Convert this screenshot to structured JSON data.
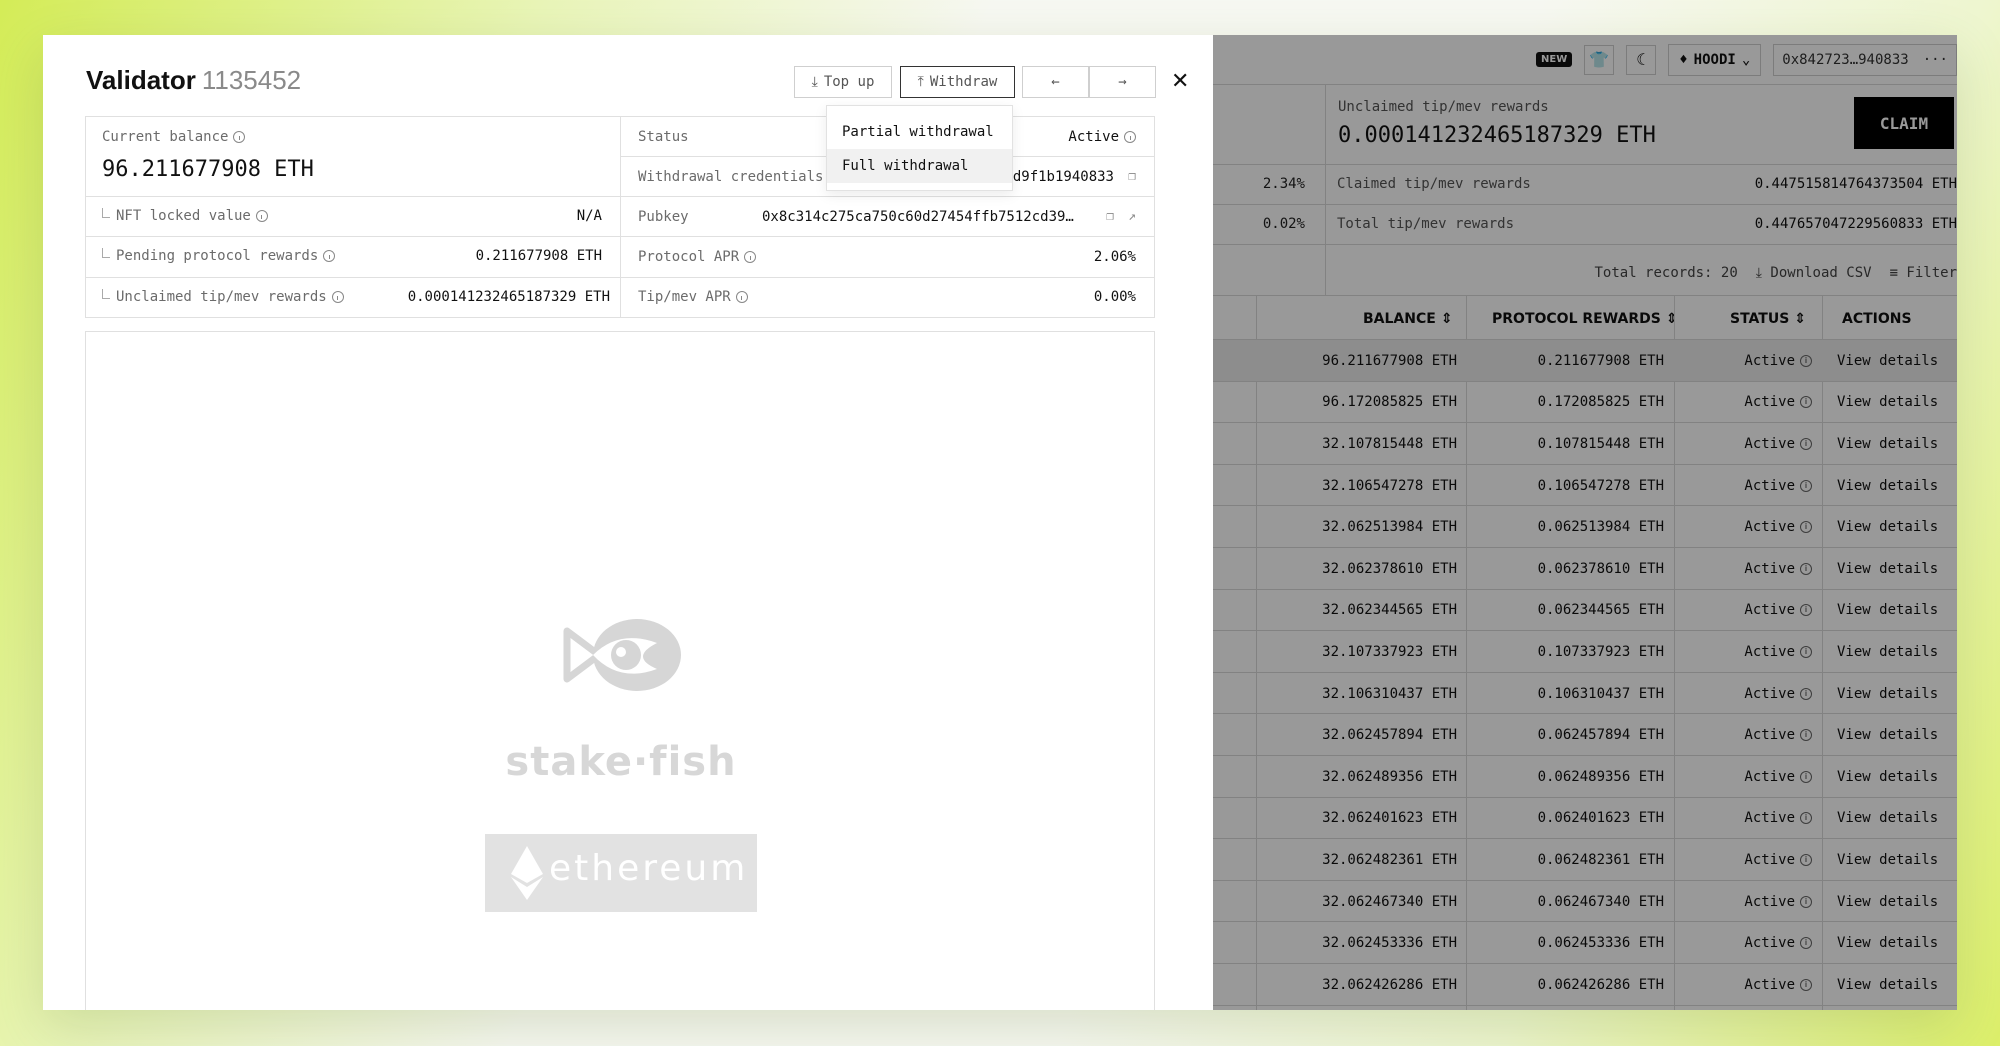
{
  "modal": {
    "title": "Validator",
    "validator_id": "1135452",
    "buttons": {
      "top_up": "Top up",
      "withdraw": "Withdraw",
      "prev": "←",
      "next": "→",
      "close": "✕"
    },
    "withdraw_menu": [
      "Partial withdrawal",
      "Full withdrawal"
    ],
    "current_balance_label": "Current balance",
    "current_balance": "96.211677908 ETH",
    "nft_locked_label": "NFT locked value",
    "nft_locked_value": "N/A",
    "pending_protocol_label": "Pending protocol rewards",
    "pending_protocol_value": "0.211677908 ETH",
    "unclaimed_label": "Unclaimed tip/mev rewards",
    "unclaimed_value": "0.000141232465187329 ETH",
    "status_label": "Status",
    "status_value": "Active",
    "withdrawal_cred_label": "Withdrawal credentials",
    "withdrawal_cred_value": "d9f1b1940833",
    "pubkey_label": "Pubkey",
    "pubkey_value": "0x8c314c275ca750c60d27454ffb7512cd39…",
    "protocol_apr_label": "Protocol APR",
    "protocol_apr_value": "2.06%",
    "tipmev_apr_label": "Tip/mev APR",
    "tipmev_apr_value": "0.00%",
    "art_brand": "stake·fish",
    "art_chain": "ethereum"
  },
  "dashboard": {
    "new_badge": "NEW",
    "network": "HOODI",
    "address": "0x842723…940833",
    "more": "···",
    "unclaimed_label": "Unclaimed tip/mev rewards",
    "unclaimed_value": "0.000141232465187329 ETH",
    "claim_button": "CLAIM",
    "rows": [
      {
        "pct": "2.34%",
        "label": "Claimed tip/mev rewards",
        "value": "0.447515814764373504 ETH"
      },
      {
        "pct": "0.02%",
        "label": "Total tip/mev rewards",
        "value": "0.447657047229560833 ETH"
      }
    ],
    "total_records": "Total records: 20",
    "download_csv": "Download CSV",
    "filter": "Filter",
    "columns": [
      "BALANCE",
      "PROTOCOL REWARDS",
      "STATUS",
      "ACTIONS"
    ],
    "table": [
      {
        "balance": "96.211677908 ETH",
        "rewards": "0.211677908 ETH",
        "status": "Active",
        "action": "View details"
      },
      {
        "balance": "96.172085825 ETH",
        "rewards": "0.172085825 ETH",
        "status": "Active",
        "action": "View details"
      },
      {
        "balance": "32.107815448 ETH",
        "rewards": "0.107815448 ETH",
        "status": "Active",
        "action": "View details"
      },
      {
        "balance": "32.106547278 ETH",
        "rewards": "0.106547278 ETH",
        "status": "Active",
        "action": "View details"
      },
      {
        "balance": "32.062513984 ETH",
        "rewards": "0.062513984 ETH",
        "status": "Active",
        "action": "View details"
      },
      {
        "balance": "32.062378610 ETH",
        "rewards": "0.062378610 ETH",
        "status": "Active",
        "action": "View details"
      },
      {
        "balance": "32.062344565 ETH",
        "rewards": "0.062344565 ETH",
        "status": "Active",
        "action": "View details"
      },
      {
        "balance": "32.107337923 ETH",
        "rewards": "0.107337923 ETH",
        "status": "Active",
        "action": "View details"
      },
      {
        "balance": "32.106310437 ETH",
        "rewards": "0.106310437 ETH",
        "status": "Active",
        "action": "View details"
      },
      {
        "balance": "32.062457894 ETH",
        "rewards": "0.062457894 ETH",
        "status": "Active",
        "action": "View details"
      },
      {
        "balance": "32.062489356 ETH",
        "rewards": "0.062489356 ETH",
        "status": "Active",
        "action": "View details"
      },
      {
        "balance": "32.062401623 ETH",
        "rewards": "0.062401623 ETH",
        "status": "Active",
        "action": "View details"
      },
      {
        "balance": "32.062482361 ETH",
        "rewards": "0.062482361 ETH",
        "status": "Active",
        "action": "View details"
      },
      {
        "balance": "32.062467340 ETH",
        "rewards": "0.062467340 ETH",
        "status": "Active",
        "action": "View details"
      },
      {
        "balance": "32.062453336 ETH",
        "rewards": "0.062453336 ETH",
        "status": "Active",
        "action": "View details"
      },
      {
        "balance": "32.062426286 ETH",
        "rewards": "0.062426286 ETH",
        "status": "Active",
        "action": "View details"
      }
    ]
  }
}
